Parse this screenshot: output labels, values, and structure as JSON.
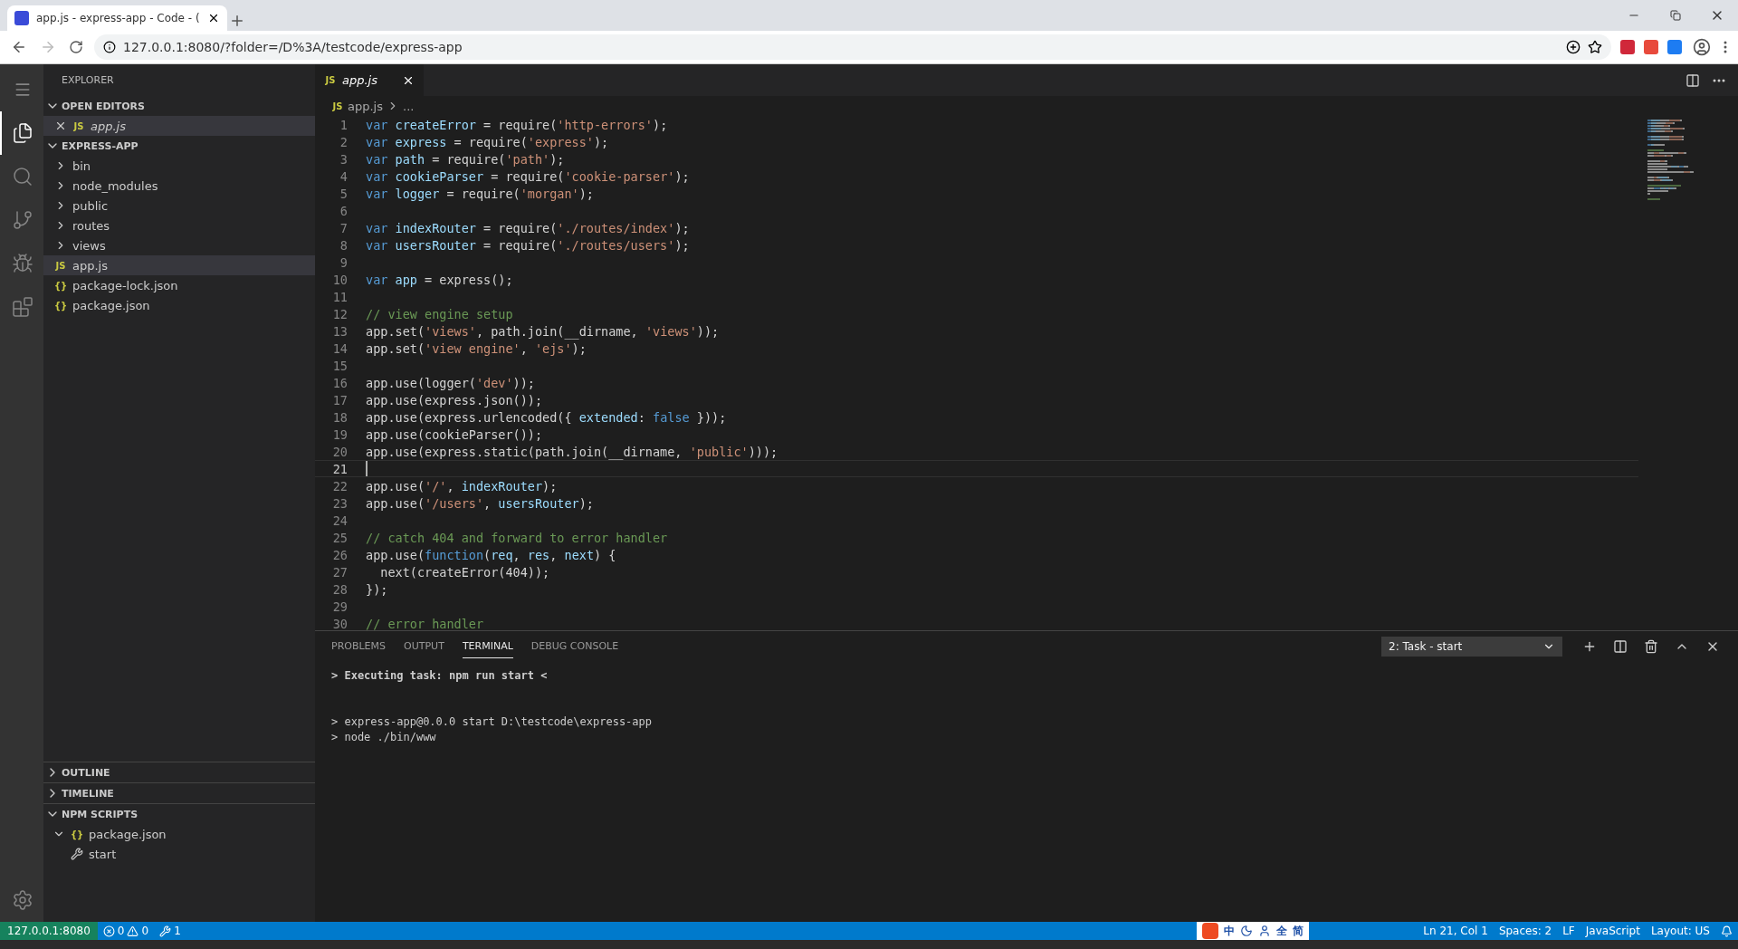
{
  "browser": {
    "tab": {
      "title": "app.js - express-app - Code - (",
      "selected": true
    },
    "address": "127.0.0.1:8080/?folder=/D%3A/testcode/express-app"
  },
  "activity_bar": [
    {
      "kind": "files",
      "selected": true
    },
    {
      "kind": "search",
      "selected": false
    },
    {
      "kind": "scm",
      "selected": false
    },
    {
      "kind": "run",
      "selected": false
    },
    {
      "kind": "extensions",
      "selected": false
    }
  ],
  "sidebar": {
    "title": "EXPLORER",
    "sections": [
      {
        "title": "OPEN EDITORS",
        "expanded": true,
        "items": [
          {
            "label": "app.js",
            "kind": "js",
            "icon": "JS",
            "closable": true,
            "selected": true
          }
        ]
      },
      {
        "title": "EXPRESS-APP",
        "expanded": true,
        "items": [
          {
            "label": "bin",
            "kind": "folder",
            "expanded": false,
            "selected": false
          },
          {
            "label": "node_modules",
            "kind": "folder",
            "expanded": false,
            "selected": false
          },
          {
            "label": "public",
            "kind": "folder",
            "expanded": false,
            "selected": false
          },
          {
            "label": "routes",
            "kind": "folder",
            "expanded": false,
            "selected": false
          },
          {
            "label": "views",
            "kind": "folder",
            "expanded": false,
            "selected": false
          },
          {
            "label": "app.js",
            "kind": "js",
            "icon": "JS",
            "selected": true
          },
          {
            "label": "package-lock.json",
            "kind": "json",
            "icon": "{}",
            "selected": false
          },
          {
            "label": "package.json",
            "kind": "json",
            "icon": "{}",
            "selected": false
          }
        ]
      }
    ],
    "bottom_sections": [
      {
        "title": "OUTLINE",
        "expanded": false
      },
      {
        "title": "TIMELINE",
        "expanded": false
      },
      {
        "title": "NPM SCRIPTS",
        "expanded": true,
        "items": [
          {
            "label": "package.json",
            "kind": "json",
            "icon": "{}",
            "expanded": true,
            "children": [
              {
                "label": "start",
                "kind": "script"
              }
            ]
          }
        ]
      }
    ]
  },
  "editor": {
    "tabs": [
      {
        "label": "app.js",
        "icon": "JS",
        "selected": true
      }
    ],
    "breadcrumb_icon": "JS",
    "breadcrumb": [
      "app.js",
      "..."
    ],
    "lines": [
      {
        "n": "1",
        "tokens": [
          {
            "kind": "keyword",
            "text": "var "
          },
          {
            "kind": "variable",
            "text": "createError"
          },
          {
            "kind": "plain",
            "text": " = require("
          },
          {
            "kind": "string",
            "text": "'http-errors'"
          },
          {
            "kind": "plain",
            "text": ");"
          }
        ]
      },
      {
        "n": "2",
        "tokens": [
          {
            "kind": "keyword",
            "text": "var "
          },
          {
            "kind": "variable",
            "text": "express"
          },
          {
            "kind": "plain",
            "text": " = require("
          },
          {
            "kind": "string",
            "text": "'express'"
          },
          {
            "kind": "plain",
            "text": ");"
          }
        ]
      },
      {
        "n": "3",
        "tokens": [
          {
            "kind": "keyword",
            "text": "var "
          },
          {
            "kind": "variable",
            "text": "path"
          },
          {
            "kind": "plain",
            "text": " = require("
          },
          {
            "kind": "string",
            "text": "'path'"
          },
          {
            "kind": "plain",
            "text": ");"
          }
        ]
      },
      {
        "n": "4",
        "tokens": [
          {
            "kind": "keyword",
            "text": "var "
          },
          {
            "kind": "variable",
            "text": "cookieParser"
          },
          {
            "kind": "plain",
            "text": " = require("
          },
          {
            "kind": "string",
            "text": "'cookie-parser'"
          },
          {
            "kind": "plain",
            "text": ");"
          }
        ]
      },
      {
        "n": "5",
        "tokens": [
          {
            "kind": "keyword",
            "text": "var "
          },
          {
            "kind": "variable",
            "text": "logger"
          },
          {
            "kind": "plain",
            "text": " = require("
          },
          {
            "kind": "string",
            "text": "'morgan'"
          },
          {
            "kind": "plain",
            "text": ");"
          }
        ]
      },
      {
        "n": "6"
      },
      {
        "n": "7",
        "tokens": [
          {
            "kind": "keyword",
            "text": "var "
          },
          {
            "kind": "variable",
            "text": "indexRouter"
          },
          {
            "kind": "plain",
            "text": " = require("
          },
          {
            "kind": "string",
            "text": "'./routes/index'"
          },
          {
            "kind": "plain",
            "text": ");"
          }
        ]
      },
      {
        "n": "8",
        "tokens": [
          {
            "kind": "keyword",
            "text": "var "
          },
          {
            "kind": "variable",
            "text": "usersRouter"
          },
          {
            "kind": "plain",
            "text": " = require("
          },
          {
            "kind": "string",
            "text": "'./routes/users'"
          },
          {
            "kind": "plain",
            "text": ");"
          }
        ]
      },
      {
        "n": "9"
      },
      {
        "n": "10",
        "tokens": [
          {
            "kind": "keyword",
            "text": "var "
          },
          {
            "kind": "variable",
            "text": "app"
          },
          {
            "kind": "plain",
            "text": " = express();"
          }
        ]
      },
      {
        "n": "11"
      },
      {
        "n": "12",
        "tokens": [
          {
            "kind": "comment",
            "text": "// view engine setup"
          }
        ]
      },
      {
        "n": "13",
        "tokens": [
          {
            "kind": "plain",
            "text": "app.set("
          },
          {
            "kind": "string",
            "text": "'views'"
          },
          {
            "kind": "plain",
            "text": ", path.join(__dirname, "
          },
          {
            "kind": "string",
            "text": "'views'"
          },
          {
            "kind": "plain",
            "text": "));"
          }
        ]
      },
      {
        "n": "14",
        "tokens": [
          {
            "kind": "plain",
            "text": "app.set("
          },
          {
            "kind": "string",
            "text": "'view engine'"
          },
          {
            "kind": "plain",
            "text": ", "
          },
          {
            "kind": "string",
            "text": "'ejs'"
          },
          {
            "kind": "plain",
            "text": ");"
          }
        ]
      },
      {
        "n": "15"
      },
      {
        "n": "16",
        "tokens": [
          {
            "kind": "plain",
            "text": "app.use(logger("
          },
          {
            "kind": "string",
            "text": "'dev'"
          },
          {
            "kind": "plain",
            "text": "));"
          }
        ]
      },
      {
        "n": "17",
        "tokens": [
          {
            "kind": "plain",
            "text": "app.use(express.json());"
          }
        ]
      },
      {
        "n": "18",
        "tokens": [
          {
            "kind": "plain",
            "text": "app.use(express.urlencoded({ "
          },
          {
            "kind": "variable",
            "text": "extended"
          },
          {
            "kind": "plain",
            "text": ": "
          },
          {
            "kind": "keyword",
            "text": "false"
          },
          {
            "kind": "plain",
            "text": " }));"
          }
        ]
      },
      {
        "n": "19",
        "tokens": [
          {
            "kind": "plain",
            "text": "app.use(cookieParser());"
          }
        ]
      },
      {
        "n": "20",
        "tokens": [
          {
            "kind": "plain",
            "text": "app.use(express.static(path.join(__dirname, "
          },
          {
            "kind": "string",
            "text": "'public'"
          },
          {
            "kind": "plain",
            "text": ")));"
          }
        ]
      },
      {
        "n": "21",
        "current": true
      },
      {
        "n": "22",
        "tokens": [
          {
            "kind": "plain",
            "text": "app.use("
          },
          {
            "kind": "string",
            "text": "'/'"
          },
          {
            "kind": "plain",
            "text": ", "
          },
          {
            "kind": "variable",
            "text": "indexRouter"
          },
          {
            "kind": "plain",
            "text": ");"
          }
        ]
      },
      {
        "n": "23",
        "tokens": [
          {
            "kind": "plain",
            "text": "app.use("
          },
          {
            "kind": "string",
            "text": "'/users'"
          },
          {
            "kind": "plain",
            "text": ", "
          },
          {
            "kind": "variable",
            "text": "usersRouter"
          },
          {
            "kind": "plain",
            "text": ");"
          }
        ]
      },
      {
        "n": "24"
      },
      {
        "n": "25",
        "tokens": [
          {
            "kind": "comment",
            "text": "// catch 404 and forward to error handler"
          }
        ]
      },
      {
        "n": "26",
        "tokens": [
          {
            "kind": "plain",
            "text": "app.use("
          },
          {
            "kind": "keyword",
            "text": "function"
          },
          {
            "kind": "plain",
            "text": "("
          },
          {
            "kind": "variable",
            "text": "req"
          },
          {
            "kind": "plain",
            "text": ", "
          },
          {
            "kind": "variable",
            "text": "res"
          },
          {
            "kind": "plain",
            "text": ", "
          },
          {
            "kind": "variable",
            "text": "next"
          },
          {
            "kind": "plain",
            "text": ") {"
          }
        ]
      },
      {
        "n": "27",
        "tokens": [
          {
            "kind": "plain",
            "text": "  next(createError(404));"
          }
        ]
      },
      {
        "n": "28",
        "tokens": [
          {
            "kind": "plain",
            "text": "});"
          }
        ]
      },
      {
        "n": "29"
      },
      {
        "n": "30",
        "tokens": [
          {
            "kind": "comment",
            "text": "// error handler"
          }
        ]
      }
    ]
  },
  "panel": {
    "tabs": [
      {
        "label": "PROBLEMS",
        "selected": false
      },
      {
        "label": "OUTPUT",
        "selected": false
      },
      {
        "label": "TERMINAL",
        "selected": true
      },
      {
        "label": "DEBUG CONSOLE",
        "selected": false
      }
    ],
    "terminal_select": "2: Task - start",
    "terminal": [
      {
        "text": "> Executing task: npm run start <",
        "bold": true
      },
      {
        "text": "> express-app@0.0.0 start D:\\testcode\\express-app",
        "bold": false,
        "gap_before": true
      },
      {
        "text": "> node ./bin/www",
        "bold": false
      }
    ]
  },
  "status_bar": {
    "remote": "127.0.0.1:8080",
    "errors": "0",
    "warnings": "0",
    "tasks": "1",
    "ime": [
      "中",
      "全",
      "简"
    ],
    "right": [
      "Ln 21, Col 1",
      "Spaces: 2",
      "LF",
      "JavaScript",
      "Layout: US"
    ]
  }
}
